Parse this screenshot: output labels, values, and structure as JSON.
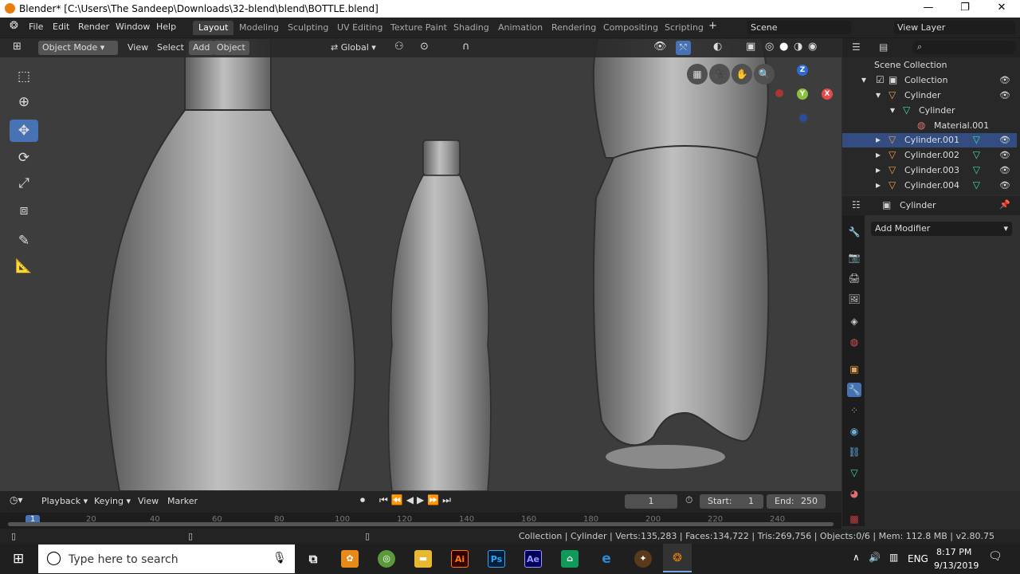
{
  "window": {
    "title": "Blender* [C:\\Users\\The Sandeep\\Downloads\\32-blend\\blend\\BOTTLE.blend]",
    "minimize": "—",
    "maximize": "❐",
    "close": "✕"
  },
  "menus": [
    "File",
    "Edit",
    "Render",
    "Window",
    "Help"
  ],
  "workspaces": [
    "Layout",
    "Modeling",
    "Sculpting",
    "UV Editing",
    "Texture Paint",
    "Shading",
    "Animation",
    "Rendering",
    "Compositing",
    "Scripting"
  ],
  "add_workspace": "+",
  "scene": "Scene",
  "view_layer": "View Layer",
  "viewport_header": {
    "mode": "Object Mode",
    "view": "View",
    "select": "Select",
    "add": "Add",
    "object": "Object",
    "orientation": "Global"
  },
  "gizmo": {
    "x": "X",
    "y": "Y",
    "z": "Z"
  },
  "outliner": {
    "root": "Scene Collection",
    "rows": [
      {
        "label": "Collection",
        "indent": 1
      },
      {
        "label": "Cylinder",
        "indent": 2
      },
      {
        "label": "Cylinder",
        "indent": 3
      },
      {
        "label": "Material.001",
        "indent": 4
      },
      {
        "label": "Cylinder.001",
        "indent": 2,
        "selected": true
      },
      {
        "label": "Cylinder.002",
        "indent": 2
      },
      {
        "label": "Cylinder.003",
        "indent": 2
      },
      {
        "label": "Cylinder.004",
        "indent": 2
      }
    ]
  },
  "properties": {
    "object": "Cylinder",
    "add_modifier": "Add Modifier"
  },
  "timeline": {
    "playback": "Playback",
    "keying": "Keying",
    "view": "View",
    "marker": "Marker",
    "current_frame": "1",
    "start_label": "Start:",
    "start": "1",
    "end_label": "End:",
    "end": "250",
    "ticks": [
      "1",
      "20",
      "40",
      "60",
      "80",
      "100",
      "120",
      "140",
      "160",
      "180",
      "200",
      "220",
      "240"
    ]
  },
  "status": "Collection | Cylinder | Verts:135,283 | Faces:134,722 | Tris:269,756 | Objects:0/6 | Mem: 112.8 MB | v2.80.75",
  "taskbar": {
    "search_placeholder": "Type here to search",
    "lang": "ENG",
    "time": "8:17 PM",
    "date": "9/13/2019",
    "icons": [
      {
        "name": "ai",
        "label": "Ai",
        "color": "#ff7c00",
        "bg": "#330000"
      },
      {
        "name": "ps",
        "label": "Ps",
        "color": "#31a8ff",
        "bg": "#001e36"
      },
      {
        "name": "ae",
        "label": "Ae",
        "color": "#9999ff",
        "bg": "#00005b"
      }
    ]
  }
}
